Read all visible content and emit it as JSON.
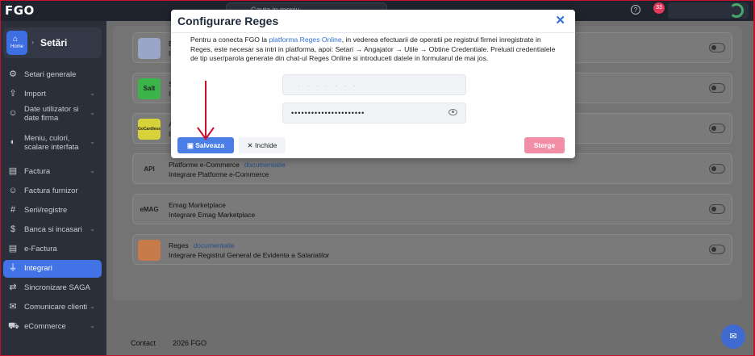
{
  "app": {
    "logo": "FGO"
  },
  "topbar": {
    "search_placeholder": "Cauta in meniu",
    "notif_count": "33"
  },
  "sidebar": {
    "home_label": "Home",
    "title": "Setări",
    "items": [
      {
        "label": "Setari generale",
        "icon": "gear-icon",
        "glyph": "⚙",
        "chevron": false
      },
      {
        "label": "Import",
        "icon": "upload-icon",
        "glyph": "⇪",
        "chevron": true
      },
      {
        "label": "Date utilizator si date firma",
        "icon": "user-icon",
        "glyph": "☺",
        "chevron": true
      },
      {
        "label": "Meniu, culori, scalare interfata",
        "icon": "palette-icon",
        "glyph": "◐",
        "chevron": true
      },
      {
        "label": "Factura",
        "icon": "document-icon",
        "glyph": "▤",
        "chevron": true
      },
      {
        "label": "Factura furnizor",
        "icon": "supplier-icon",
        "glyph": "☺",
        "chevron": false
      },
      {
        "label": "Serii/registre",
        "icon": "hash-icon",
        "glyph": "#",
        "chevron": false
      },
      {
        "label": "Banca si incasari",
        "icon": "bank-icon",
        "glyph": "$",
        "chevron": true
      },
      {
        "label": "e-Factura",
        "icon": "efactura-icon",
        "glyph": "▤",
        "chevron": false
      },
      {
        "label": "Integrari",
        "icon": "plug-icon",
        "glyph": "⏚",
        "chevron": false
      },
      {
        "label": "Sincronizare SAGA",
        "icon": "sync-icon",
        "glyph": "⇄",
        "chevron": false
      },
      {
        "label": "Comunicare clienti",
        "icon": "mail-icon",
        "glyph": "✉",
        "chevron": true
      },
      {
        "label": "eCommerce",
        "icon": "cart-icon",
        "glyph": "⛟",
        "chevron": true
      }
    ],
    "active_label": "Integrari"
  },
  "integrations": [
    {
      "title": "Ban",
      "doc": "",
      "subtitle": "Integr",
      "logo_text": "",
      "logo_color": "#9aa6c8"
    },
    {
      "title": "Salt",
      "doc": "",
      "subtitle": "Integ",
      "logo_text": "Salt",
      "logo_color": "#3bb54a"
    },
    {
      "title": "Alte",
      "doc": "",
      "subtitle": "Integ",
      "logo_text": "GoCardless",
      "logo_color": "#d8d23a"
    },
    {
      "title": "Platforme e-Commerce",
      "doc": "documentatie",
      "subtitle": "Integrare Platforme e-Commerce",
      "logo_text": "API",
      "logo_color": "#7a7a7a"
    },
    {
      "title": "Emag Marketplace",
      "doc": "",
      "subtitle": "Integrare Emag Marketplace",
      "logo_text": "eMAG",
      "logo_color": "#7a7a7a"
    },
    {
      "title": "Reges",
      "doc": "documentatie",
      "subtitle": "Integrare Registrul General de Evidenta a Salariatilor",
      "logo_text": "",
      "logo_color": "#c77a4a"
    }
  ],
  "footer": {
    "contact": "Contact",
    "copyright": "2026 FGO"
  },
  "modal": {
    "title": "Configurare Reges",
    "desc_part1": "Pentru a conecta FGO la ",
    "desc_link": "platforma Reges Online",
    "desc_part2": ", in vederea efectuarii de operatii pe registrul firmei inregistrate in Reges, este necesar sa intri in platforma, apoi: Setari → Angajator → Utile → Obtine Credentiale. Preluati credentialele de tip user/parola generate din chat-ul Reges Online si introduceti datele in formularul de mai jos.",
    "username_value": "· · ·  · · · ·",
    "password_value": "••••••••••••••••••••••",
    "save_label": "Salveaza",
    "close_label": "Inchide",
    "delete_label": "Sterge"
  },
  "colors": {
    "accent": "#4172e6",
    "delete": "#f28fa7",
    "sidebar": "#2a2f3a",
    "annotation": "#c8102e"
  }
}
